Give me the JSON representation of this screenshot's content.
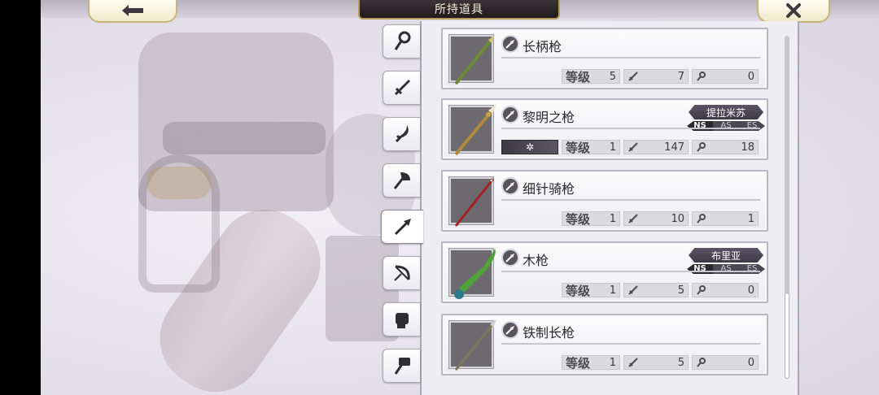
{
  "header": {
    "title": "所持道具",
    "back_icon": "arrow-left-icon",
    "close_icon": "close-icon"
  },
  "category_tabs": [
    {
      "icon": "staff-icon",
      "active": false
    },
    {
      "icon": "sword-icon",
      "active": false
    },
    {
      "icon": "curved-sword-icon",
      "active": false
    },
    {
      "icon": "axe-icon",
      "active": false
    },
    {
      "icon": "lance-icon",
      "active": true
    },
    {
      "icon": "bow-icon",
      "active": false
    },
    {
      "icon": "gauntlet-icon",
      "active": false
    },
    {
      "icon": "hammer-icon",
      "active": false
    }
  ],
  "labels": {
    "level": "等级"
  },
  "items": [
    {
      "name": "长柄枪",
      "level": "5",
      "attack": "7",
      "hit": "0",
      "owner": null,
      "color": "#6e8b3a"
    },
    {
      "name": "黎明之枪",
      "level": "1",
      "attack": "147",
      "hit": "18",
      "owner": "提拉米苏",
      "special_icon": "snowflake-icon",
      "nas": [
        "NS",
        "AS",
        "ES"
      ],
      "color": "#c9a24b"
    },
    {
      "name": "细针骑枪",
      "level": "1",
      "attack": "10",
      "hit": "1",
      "owner": null,
      "color": "#a3222a"
    },
    {
      "name": "木枪",
      "level": "1",
      "attack": "5",
      "hit": "0",
      "owner": "布里亚",
      "nas": [
        "NS",
        "AS",
        "ES"
      ],
      "color": "#4fa33a"
    },
    {
      "name": "铁制长枪",
      "level": "1",
      "attack": "5",
      "hit": "0",
      "owner": null,
      "color": "#7a7a5a"
    }
  ],
  "colors": {
    "panel_bg": "#eeeef2",
    "header_plate": "#2b2528",
    "gold_trim": "#b79a53"
  }
}
